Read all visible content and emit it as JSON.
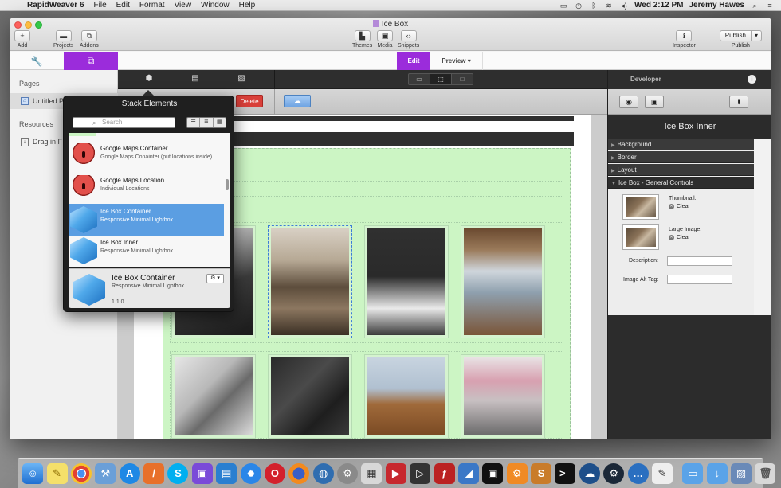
{
  "menubar": {
    "app": "RapidWeaver 6",
    "items": [
      "File",
      "Edit",
      "Format",
      "View",
      "Window",
      "Help"
    ],
    "clock": "Wed 2:12 PM",
    "user": "Jeremy Hawes"
  },
  "window": {
    "title": "Ice Box",
    "toolbar": {
      "add": "Add",
      "projects": "Projects",
      "addons": "Addons",
      "themes": "Themes",
      "media": "Media",
      "snippets": "Snippets",
      "inspector": "Inspector",
      "publish_button": "Publish",
      "publish": "Publish"
    },
    "modes": {
      "edit": "Edit",
      "preview": "Preview"
    }
  },
  "sidebar": {
    "pages_heading": "Pages",
    "page_item": "Untitled P",
    "resources_heading": "Resources",
    "resource_item": "Drag in F"
  },
  "stacks_toolbar": {
    "delete": "Delete"
  },
  "stack_elements": {
    "title": "Stack Elements",
    "search_placeholder": "Search",
    "items": [
      {
        "name": "Google Maps Container",
        "desc": "Google Maps Conainter (put locations inside)",
        "icon": "google-maps-icon"
      },
      {
        "name": "Google Maps Location",
        "desc": "Individual Locations",
        "icon": "google-maps-icon"
      },
      {
        "name": "Ice Box Container",
        "desc": "Responsive Minimal Lightbox",
        "icon": "ice-box-cube-icon",
        "selected": true
      },
      {
        "name": "Ice Box Inner",
        "desc": "Responsive Minimal Lightbox",
        "icon": "ice-box-cube-icon"
      }
    ],
    "detail": {
      "name": "Ice Box Container",
      "desc": "Responsive Minimal Lightbox",
      "version": "1.1.0"
    }
  },
  "inspector": {
    "top_label": "Developer",
    "title": "Ice Box Inner",
    "sections": [
      "Background",
      "Border",
      "Layout",
      "Ice Box - General Controls"
    ],
    "thumbnail_label": "Thumbnail:",
    "large_image_label": "Large Image:",
    "clear": "Clear",
    "description_label": "Description:",
    "alt_label": "Image Alt Tag:"
  },
  "colors": {
    "accent": "#9b2cdb",
    "delete": "#d9403a",
    "selection": "#5b9ee2",
    "ice_box_bg": "#ccf5c4"
  }
}
